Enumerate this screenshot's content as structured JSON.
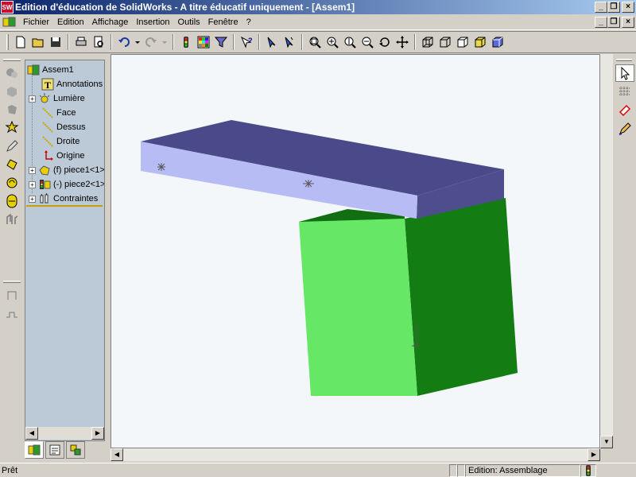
{
  "window": {
    "title": "Edition d'éducation de SolidWorks - A titre éducatif uniquement - [Assem1]",
    "app_icon_text": "SW",
    "btn_minimize": "_",
    "btn_restore": "❐",
    "btn_close": "×"
  },
  "menubar": {
    "items": [
      "Fichier",
      "Edition",
      "Affichage",
      "Insertion",
      "Outils",
      "Fenêtre",
      "?"
    ]
  },
  "tree": {
    "items": [
      {
        "label": "Assem1",
        "icon": "assembly-icon"
      },
      {
        "label": "Annotations",
        "icon": "annotations-icon"
      },
      {
        "label": "Lumière",
        "icon": "light-icon"
      },
      {
        "label": "Face",
        "icon": "plane-icon"
      },
      {
        "label": "Dessus",
        "icon": "plane-icon"
      },
      {
        "label": "Droite",
        "icon": "plane-icon"
      },
      {
        "label": "Origine",
        "icon": "origin-icon"
      },
      {
        "label": "(f) piece1<1>",
        "icon": "part-icon"
      },
      {
        "label": "(-) piece2<1>",
        "icon": "part-icon"
      },
      {
        "label": "Contraintes",
        "icon": "mates-icon"
      }
    ],
    "expander_plus": "+"
  },
  "status": {
    "left": "Prêt",
    "mode": "Edition: Assemblage"
  },
  "colors": {
    "beam_top": "#4a4a8a",
    "beam_front": "#b8bcf5",
    "beam_side": "#4e4e8e",
    "block_front": "#66e866",
    "block_side": "#137d13",
    "block_top": "#126e12",
    "viewport_bg": "#f4f7f9"
  }
}
